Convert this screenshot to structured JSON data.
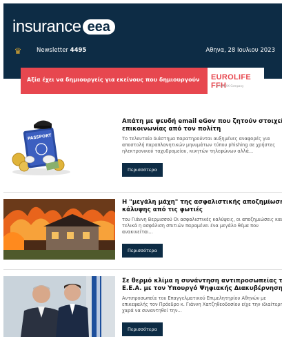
{
  "header": {
    "logo_text": "insurance",
    "logo_pill": "eea",
    "crest_icon": "greek-crest-icon",
    "newsletter_label": "Newsletter",
    "newsletter_number": "4495",
    "date": "Αθηνα, 28 Ιουλιου 2023"
  },
  "ad": {
    "slogan": "Αξία έχει να δημιουργείς για εκείνους που δημιουργούν",
    "brand": "EUROLIFE FFH",
    "brand_sub": "A FAIRFAX Company",
    "accent_color": "#e7474f"
  },
  "articles": [
    {
      "title_line1": "Απάτη με ψευδή email eGov που ζητούν στοιχεία",
      "title_line2": "επικοινωνίας από τον πολίτη",
      "excerpt_line1": "Το τελευταίο διάστημα παρατηρούνται αυξημένες αναφορές για",
      "excerpt_line2": "αποστολή παραπλανητικών μηνυμάτων τύπου phishing σε χρήστες",
      "excerpt_line3": "ηλεκτρονικού ταχυδρομείου, κινητών τηλεφώνων αλλά...",
      "more_label": "Περισσότερα",
      "image_icon": "passport-thief-illustration",
      "passport_text": "PASSPORT"
    },
    {
      "title_line1": "Η \"μεγάλη μάχη\" της ασφαλιστικής αποζημίωσης και",
      "title_line2": "κάλυψης από τις φωτιές",
      "excerpt_line1": "του Γιάννη Βερμισσού Οι ασφαλιστικές καλύψεις, οι αποζημιώσεις και",
      "excerpt_line2": "τελικά η ασφάλιση σπιτιών παραμένει ένα μεγάλο θέμα που",
      "excerpt_line3": "ανακινείται...",
      "more_label": "Περισσότερα",
      "image_icon": "burning-house-photo"
    },
    {
      "title_line1": "Σε θερμό κλίμα η συνάντηση αντιπροσωπείας του",
      "title_line2": "Ε.Ε.Α. με τον Υπουργό Ψηφιακής Διακυβέρνησης",
      "excerpt_line1": "Αντιπροσωπεία του Επαγγελματικού Επιμελητηρίου Αθηνών με",
      "excerpt_line2": "επικεφαλής τον Πρόεδρο κ. Γιάννη Χατζηθεοδοσίου είχε την ιδιαίτερη",
      "excerpt_line3": "χαρά να συναντηθεί την...",
      "more_label": "Περισσότερα",
      "image_icon": "two-men-photo"
    }
  ],
  "colors": {
    "header_bg": "#0d2c45",
    "button_bg": "#0d2c45"
  }
}
